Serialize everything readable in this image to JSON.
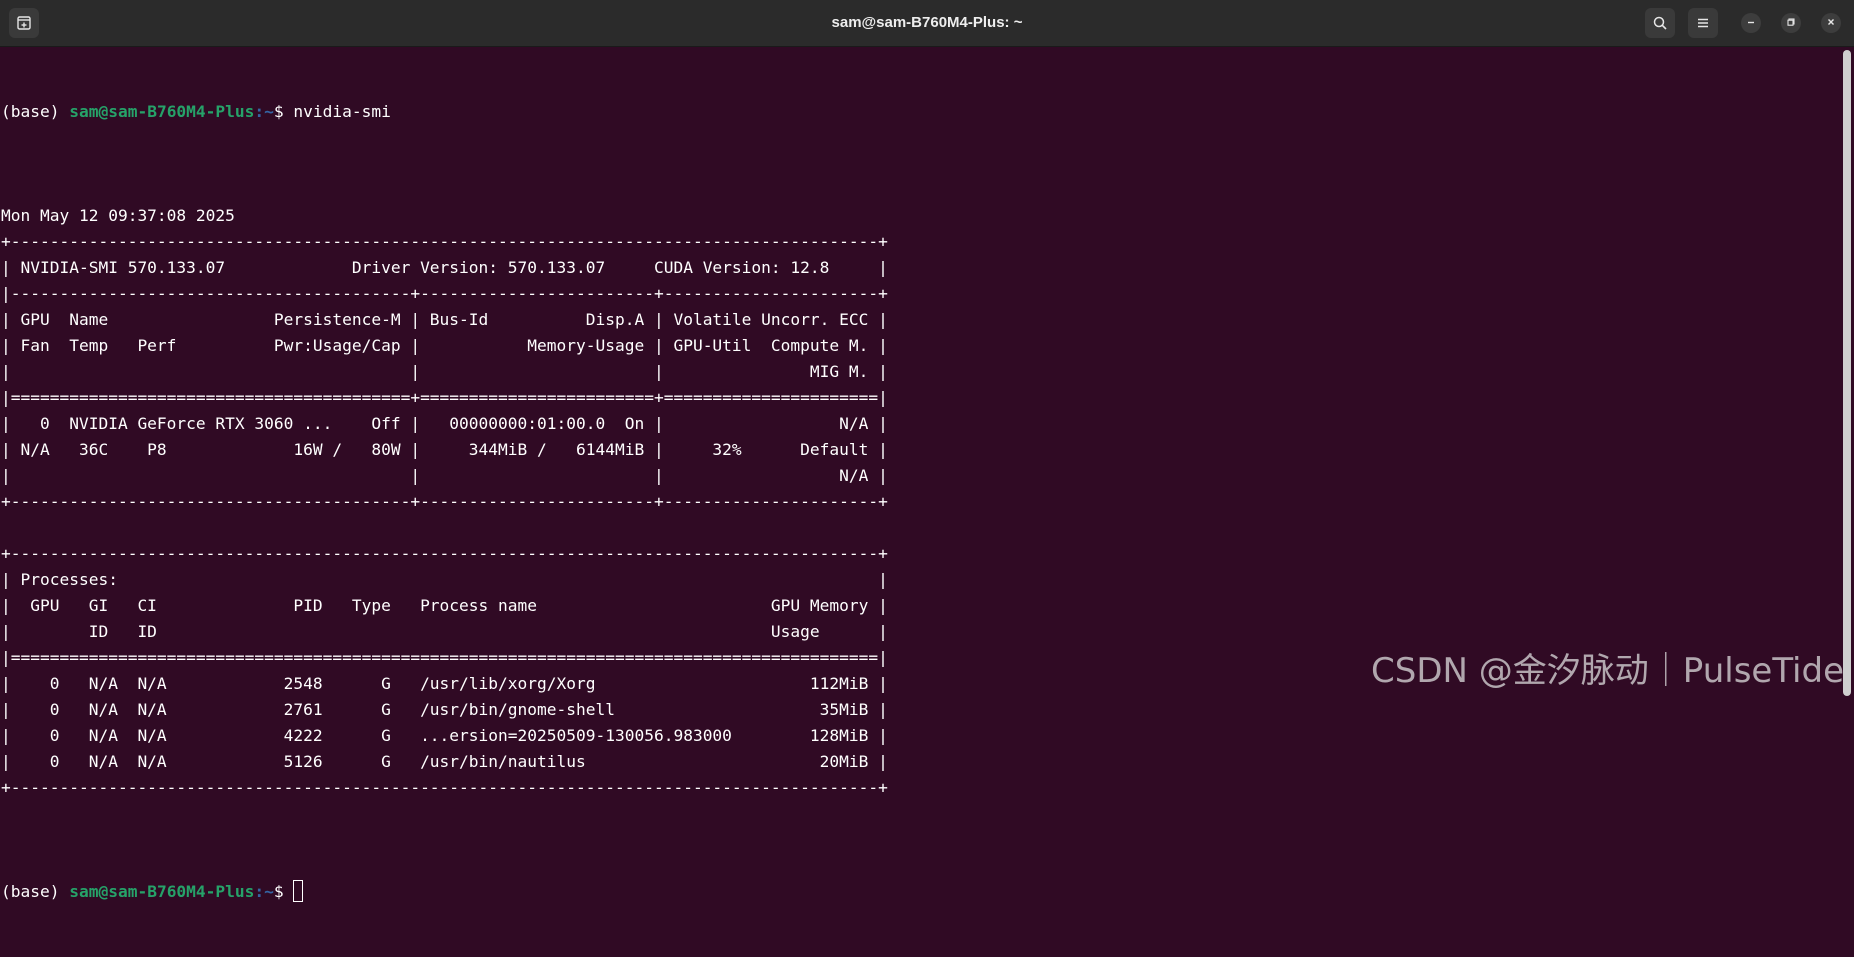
{
  "window": {
    "title": "sam@sam-B760M4-Plus: ~"
  },
  "icons": {
    "new_tab": "new-tab-icon",
    "search": "search-icon",
    "menu": "hamburger-menu-icon",
    "minimize": "minimize-icon",
    "maximize": "maximize-icon",
    "close": "close-icon"
  },
  "prompt": {
    "env": "(base) ",
    "user_host": "sam@sam-B760M4-Plus",
    "path": ":~",
    "symbol": "$ "
  },
  "first_command": "nvidia-smi",
  "output_lines": [
    "Mon May 12 09:37:08 2025",
    "+-----------------------------------------------------------------------------------------+",
    "| NVIDIA-SMI 570.133.07             Driver Version: 570.133.07     CUDA Version: 12.8     |",
    "|-----------------------------------------+------------------------+----------------------+",
    "| GPU  Name                 Persistence-M | Bus-Id          Disp.A | Volatile Uncorr. ECC |",
    "| Fan  Temp   Perf          Pwr:Usage/Cap |           Memory-Usage | GPU-Util  Compute M. |",
    "|                                         |                        |               MIG M. |",
    "|=========================================+========================+======================|",
    "|   0  NVIDIA GeForce RTX 3060 ...    Off |   00000000:01:00.0  On |                  N/A |",
    "| N/A   36C    P8             16W /   80W |     344MiB /   6144MiB |     32%      Default |",
    "|                                         |                        |                  N/A |",
    "+-----------------------------------------+------------------------+----------------------+",
    "",
    "+-----------------------------------------------------------------------------------------+",
    "| Processes:                                                                              |",
    "|  GPU   GI   CI              PID   Type   Process name                        GPU Memory |",
    "|        ID   ID                                                               Usage      |",
    "|=========================================================================================|",
    "|    0   N/A  N/A            2548      G   /usr/lib/xorg/Xorg                      112MiB |",
    "|    0   N/A  N/A            2761      G   /usr/bin/gnome-shell                     35MiB |",
    "|    0   N/A  N/A            4222      G   ...ersion=20250509-130056.983000        128MiB |",
    "|    0   N/A  N/A            5126      G   /usr/bin/nautilus                        20MiB |",
    "+-----------------------------------------------------------------------------------------+"
  ],
  "second_command": "",
  "watermark": "CSDN @金汐脉动｜PulseTide",
  "colors": {
    "background": "#300a24",
    "titlebar": "#2b2b2b",
    "prompt_user": "#26a269",
    "prompt_path": "#3465a4",
    "text": "#ffffff"
  }
}
